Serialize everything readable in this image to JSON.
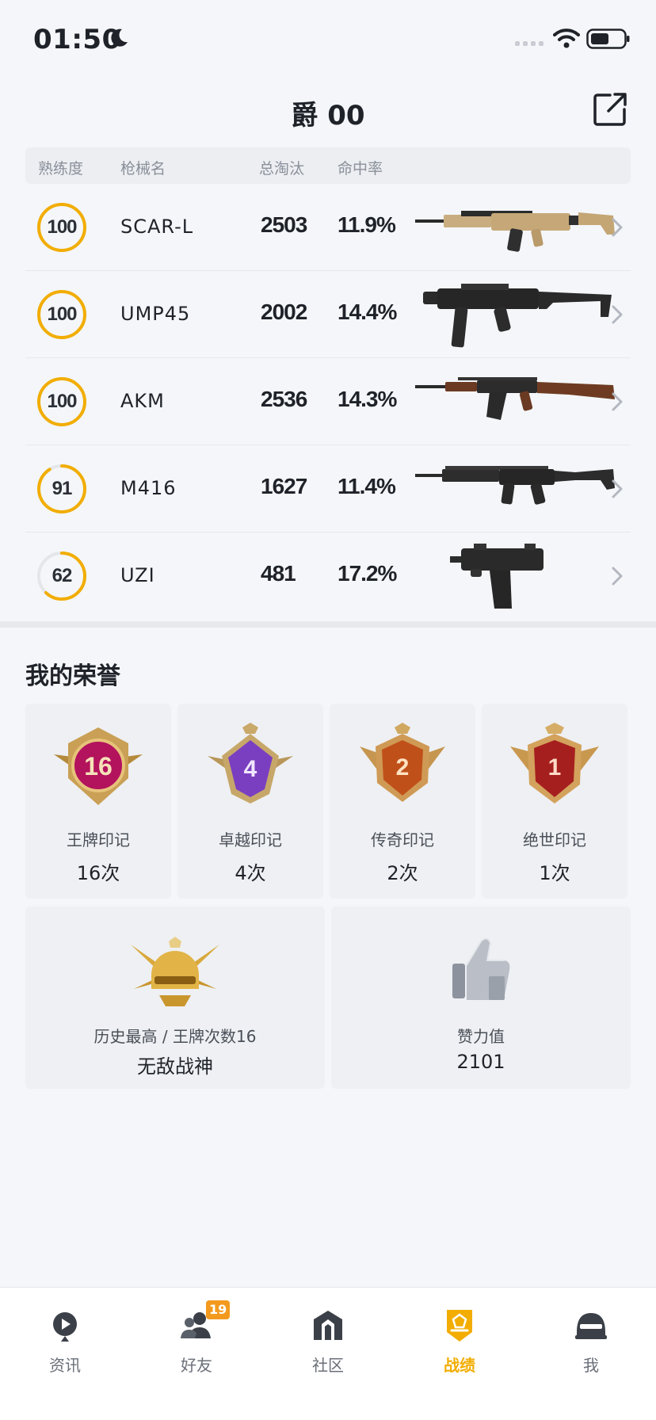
{
  "status_bar": {
    "time": "01:50"
  },
  "header": {
    "title": "爵 00"
  },
  "table": {
    "columns": [
      "熟练度",
      "枪械名",
      "总淘汰",
      "命中率"
    ],
    "rows": [
      {
        "proficiency": "100",
        "proficiency_ratio": 1.0,
        "name": "SCAR-L",
        "kills": "2503",
        "hit_rate": "11.9%",
        "gun": "scar-l-rifle"
      },
      {
        "proficiency": "100",
        "proficiency_ratio": 1.0,
        "name": "UMP45",
        "kills": "2002",
        "hit_rate": "14.4%",
        "gun": "ump45-smg"
      },
      {
        "proficiency": "100",
        "proficiency_ratio": 1.0,
        "name": "AKM",
        "kills": "2536",
        "hit_rate": "14.3%",
        "gun": "akm-rifle"
      },
      {
        "proficiency": "91",
        "proficiency_ratio": 0.91,
        "name": "M416",
        "kills": "1627",
        "hit_rate": "11.4%",
        "gun": "m416-rifle"
      },
      {
        "proficiency": "62",
        "proficiency_ratio": 0.62,
        "name": "UZI",
        "kills": "481",
        "hit_rate": "17.2%",
        "gun": "uzi-smg"
      }
    ]
  },
  "honors": {
    "title": "我的荣誉",
    "badges": [
      {
        "emblem_number": "16",
        "label": "王牌印记",
        "count": "16次",
        "color": "#c0186a"
      },
      {
        "emblem_number": "4",
        "label": "卓越印记",
        "count": "4次",
        "color": "#7a3fc0"
      },
      {
        "emblem_number": "2",
        "label": "传奇印记",
        "count": "2次",
        "color": "#c0501a"
      },
      {
        "emblem_number": "1",
        "label": "绝世印记",
        "count": "1次",
        "color": "#a61f1f"
      }
    ],
    "history": {
      "label": "历史最高 / 王牌次数16",
      "value": "无敌战神"
    },
    "likes": {
      "label": "赞力值",
      "value": "2101"
    }
  },
  "tab_bar": {
    "items": [
      {
        "label": "资讯",
        "icon": "news-icon",
        "active": false
      },
      {
        "label": "好友",
        "icon": "friends-icon",
        "active": false,
        "badge": "19"
      },
      {
        "label": "社区",
        "icon": "community-icon",
        "active": false
      },
      {
        "label": "战绩",
        "icon": "record-icon",
        "active": true
      },
      {
        "label": "我",
        "icon": "helmet-icon",
        "active": false
      }
    ]
  },
  "colors": {
    "accent": "#f2ad00",
    "ring_track": "#e4e6ea"
  }
}
